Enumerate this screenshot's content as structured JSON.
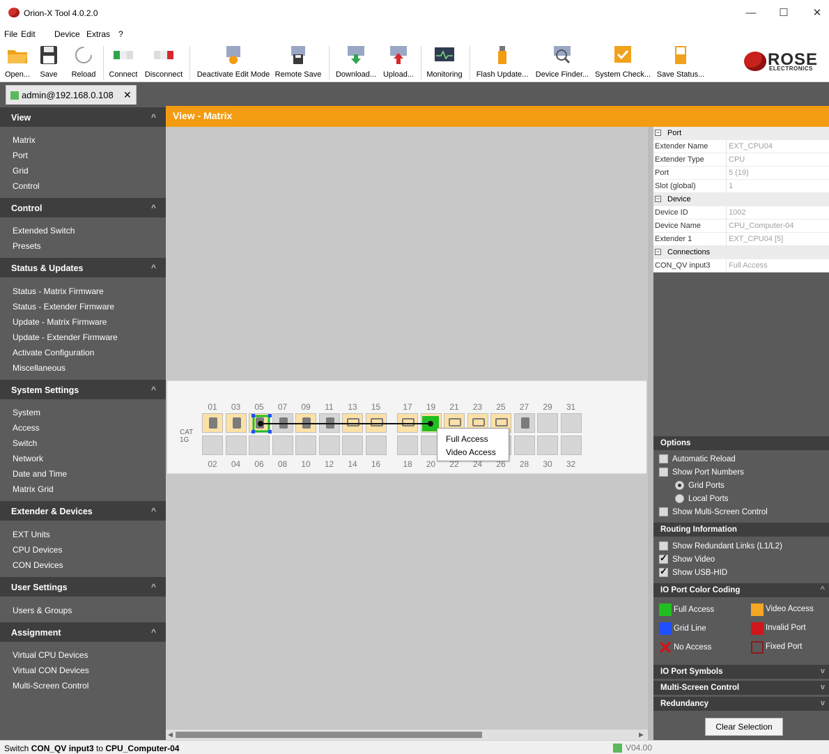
{
  "window": {
    "title": "Orion-X Tool 4.0.2.0",
    "minimize": "—",
    "maximize": "☐",
    "close": "✕"
  },
  "menu": [
    "File",
    "Edit",
    "Device",
    "Extras",
    "?"
  ],
  "toolbar": {
    "open": "Open...",
    "save": "Save",
    "reload": "Reload",
    "connect": "Connect",
    "disconnect": "Disconnect",
    "deactivate": "Deactivate Edit Mode",
    "remote_save": "Remote Save",
    "download": "Download...",
    "upload": "Upload...",
    "monitoring": "Monitoring",
    "flash": "Flash Update...",
    "finder": "Device Finder...",
    "syscheck": "System Check...",
    "savestatus": "Save Status..."
  },
  "logo": {
    "name": "ROSE",
    "sub": "ELECTRONICS"
  },
  "tab": {
    "label": "admin@192.168.0.108",
    "close": "✕"
  },
  "sidebar": {
    "sections": [
      {
        "title": "View",
        "items": [
          "Matrix",
          "Port",
          "Grid",
          "Control"
        ]
      },
      {
        "title": "Control",
        "items": [
          "Extended Switch",
          "Presets"
        ]
      },
      {
        "title": "Status & Updates",
        "items": [
          "Status - Matrix Firmware",
          "Status - Extender Firmware",
          "Update - Matrix Firmware",
          "Update - Extender Firmware",
          "Activate Configuration",
          "Miscellaneous"
        ]
      },
      {
        "title": "System Settings",
        "items": [
          "System",
          "Access",
          "Switch",
          "Network",
          "Date and Time",
          "Matrix Grid"
        ]
      },
      {
        "title": "Extender & Devices",
        "items": [
          "EXT Units",
          "CPU Devices",
          "CON Devices"
        ]
      },
      {
        "title": "User Settings",
        "items": [
          "Users & Groups"
        ]
      },
      {
        "title": "Assignment",
        "items": [
          "Virtual CPU Devices",
          "Virtual CON Devices",
          "Multi-Screen Control"
        ]
      }
    ]
  },
  "view_title": "View - Matrix",
  "matrix": {
    "label_cat": "CAT",
    "label_1g": "1G",
    "top_numbers": [
      "01",
      "03",
      "05",
      "07",
      "09",
      "11",
      "13",
      "15",
      "17",
      "19",
      "21",
      "23",
      "25",
      "27",
      "29",
      "31"
    ],
    "bottom_numbers": [
      "02",
      "04",
      "06",
      "08",
      "10",
      "12",
      "14",
      "16",
      "18",
      "20",
      "22",
      "24",
      "26",
      "28",
      "30",
      "32"
    ],
    "context_menu": [
      "Full Access",
      "Video Access"
    ]
  },
  "properties": {
    "groups": [
      {
        "title": "Port",
        "rows": [
          [
            "Extender Name",
            "EXT_CPU04"
          ],
          [
            "Extender Type",
            "CPU"
          ],
          [
            "Port",
            "5 (19)"
          ],
          [
            "Slot (global)",
            "1"
          ]
        ]
      },
      {
        "title": "Device",
        "rows": [
          [
            "Device ID",
            "1002"
          ],
          [
            "Device Name",
            "CPU_Computer-04"
          ],
          [
            "Extender 1",
            "EXT_CPU04 [5]"
          ]
        ]
      },
      {
        "title": "Connections",
        "rows": [
          [
            "CON_QV input3",
            "Full Access"
          ]
        ]
      }
    ]
  },
  "options": {
    "title": "Options",
    "auto_reload": "Automatic Reload",
    "show_port_numbers": "Show Port Numbers",
    "grid_ports": "Grid Ports",
    "local_ports": "Local Ports",
    "multi_screen": "Show Multi-Screen Control"
  },
  "routing": {
    "title": "Routing Information",
    "redundant": "Show Redundant Links (L1/L2)",
    "video": "Show Video",
    "usb": "Show USB-HID"
  },
  "color_coding": {
    "title": "IO Port Color Coding",
    "items": [
      {
        "label": "Full Access",
        "color": "#1fbf1f"
      },
      {
        "label": "Video Access",
        "color": "#f5a623"
      },
      {
        "label": "Grid Line",
        "color": "#1f4fff"
      },
      {
        "label": "Invalid Port",
        "color": "#d0151b"
      },
      {
        "label": "No Access",
        "color": "#d0151b"
      },
      {
        "label": "Fixed Port",
        "color": "#8b1a1a"
      }
    ]
  },
  "collapsed": [
    "IO Port Symbols",
    "Multi-Screen Control",
    "Redundancy"
  ],
  "clear_selection": "Clear Selection",
  "status": {
    "prefix": "Switch ",
    "from": "CON_QV input3",
    "mid": " to ",
    "to": "CPU_Computer-04",
    "version": "V04.00"
  }
}
